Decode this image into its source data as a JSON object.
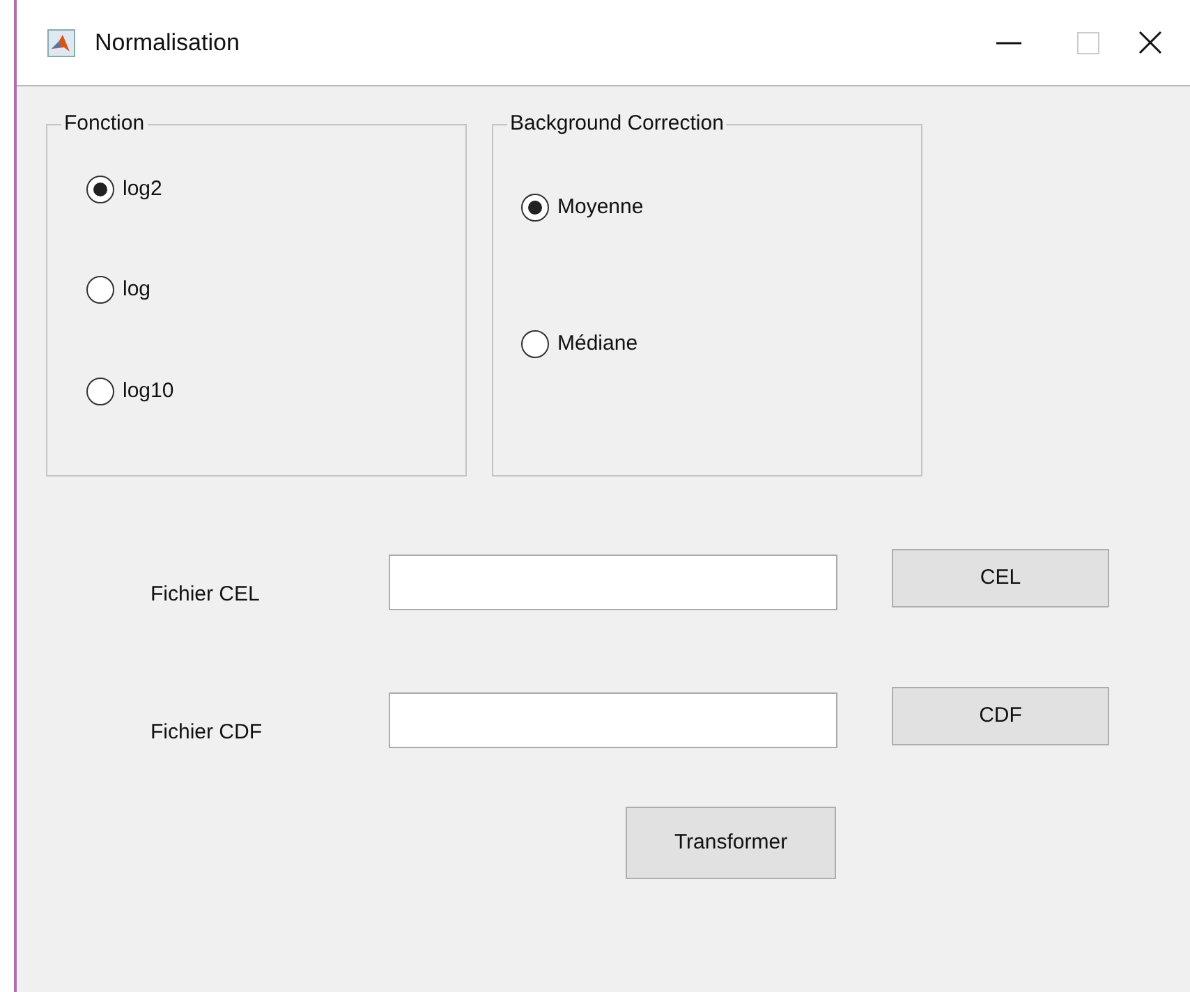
{
  "window": {
    "title": "Normalisation"
  },
  "groups": [
    {
      "title": "Fonction",
      "options": [
        {
          "label": "log2",
          "selected": true
        },
        {
          "label": "log",
          "selected": false
        },
        {
          "label": "log10",
          "selected": false
        }
      ]
    },
    {
      "title": "Background Correction",
      "options": [
        {
          "label": "Moyenne",
          "selected": true
        },
        {
          "label": "Médiane",
          "selected": false
        }
      ]
    }
  ],
  "file_rows": [
    {
      "label": "Fichier CEL",
      "button": "CEL"
    },
    {
      "label": "Fichier CDF",
      "button": "CDF"
    }
  ],
  "action_button": "Transformer"
}
